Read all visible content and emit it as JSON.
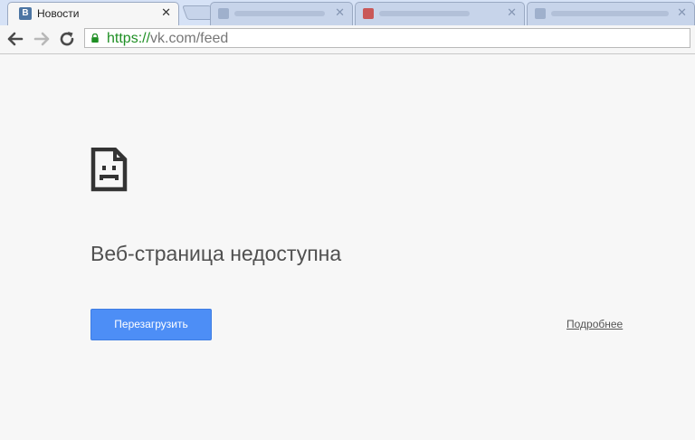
{
  "tabs": [
    {
      "title": "Новости",
      "favicon": "В",
      "active": true
    }
  ],
  "toolbar": {
    "url_scheme": "https://",
    "url_rest": "vk.com/feed"
  },
  "error": {
    "heading": "Веб-страница недоступна",
    "reload_label": "Перезагрузить",
    "details_label": "Подробнее"
  },
  "colors": {
    "accent": "#4d8ef6",
    "url_scheme": "#1f8f24",
    "tabstrip": "#d6e2f6"
  }
}
